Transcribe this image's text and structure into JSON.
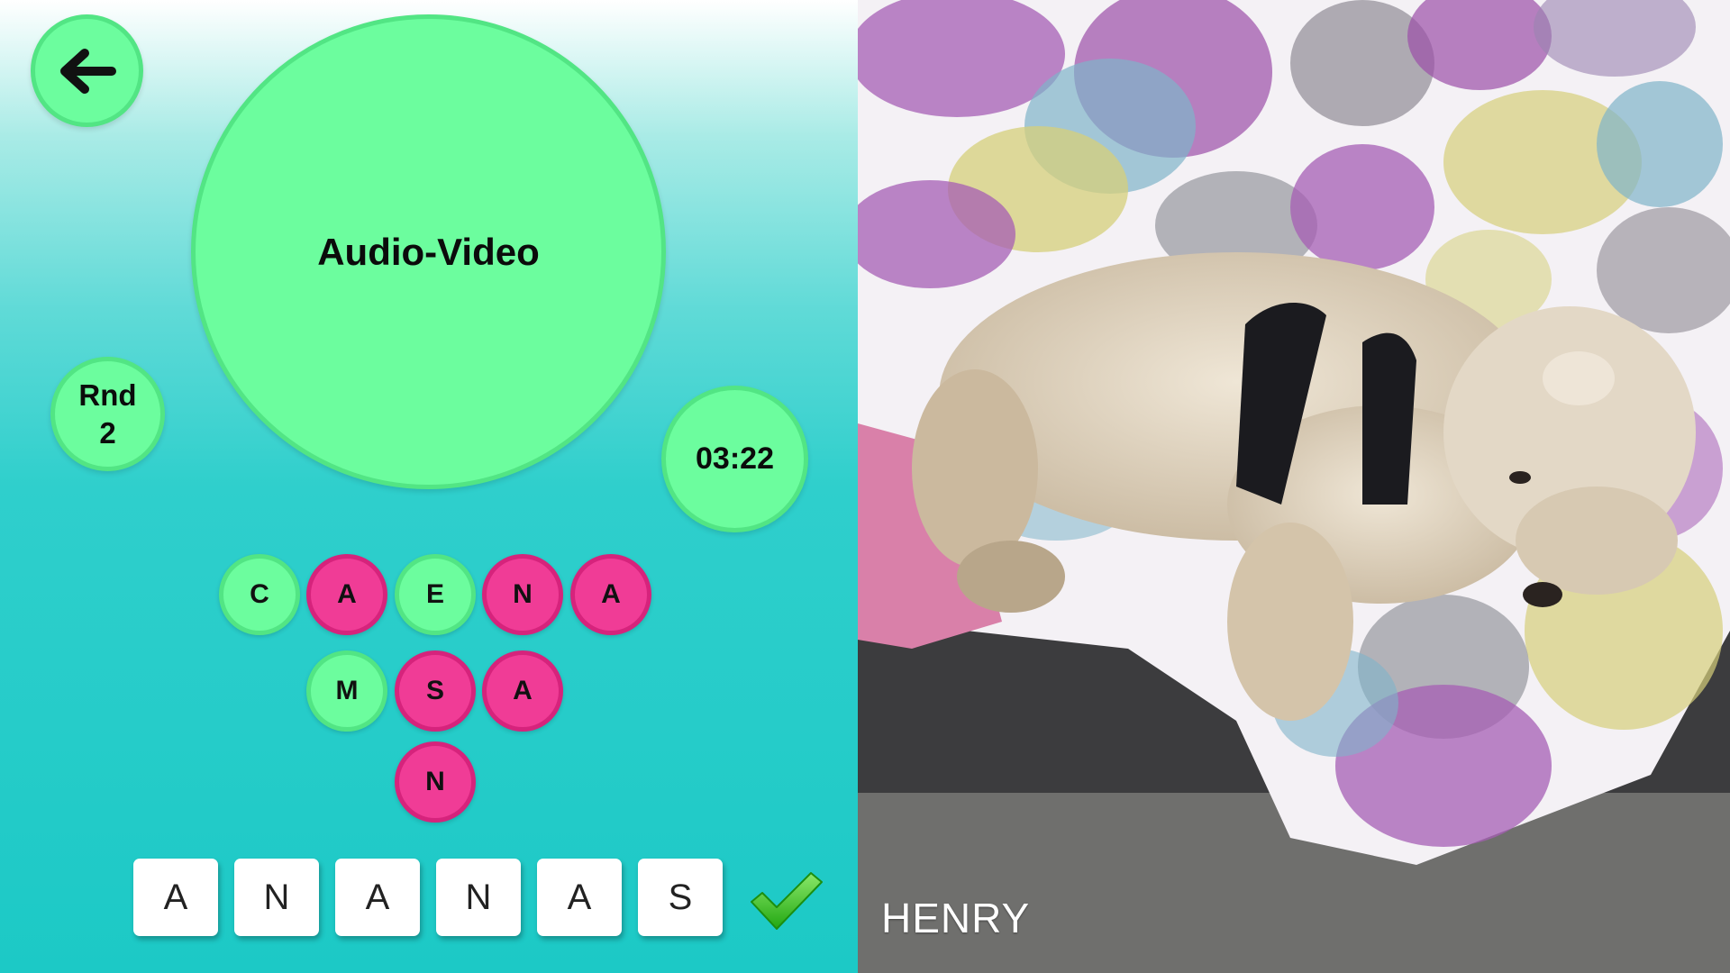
{
  "game": {
    "back_icon": "arrow-left-icon",
    "category": "Audio-Video",
    "round_label": "Rnd",
    "round_number": "2",
    "timer": "03:22",
    "letter_pool": [
      {
        "letter": "C",
        "state": "unused"
      },
      {
        "letter": "A",
        "state": "used"
      },
      {
        "letter": "E",
        "state": "unused"
      },
      {
        "letter": "N",
        "state": "used"
      },
      {
        "letter": "A",
        "state": "used"
      },
      {
        "letter": "M",
        "state": "unused"
      },
      {
        "letter": "S",
        "state": "used"
      },
      {
        "letter": "A",
        "state": "used"
      },
      {
        "letter": "N",
        "state": "used"
      }
    ],
    "answer_tiles": [
      "A",
      "N",
      "A",
      "N",
      "A",
      "S"
    ],
    "submit_icon": "checkmark-icon"
  },
  "photo": {
    "caption": "HENRY"
  },
  "colors": {
    "circle_fill": "#6cfd9e",
    "used_letter": "#f03c96",
    "check_green": "#35c41c"
  }
}
